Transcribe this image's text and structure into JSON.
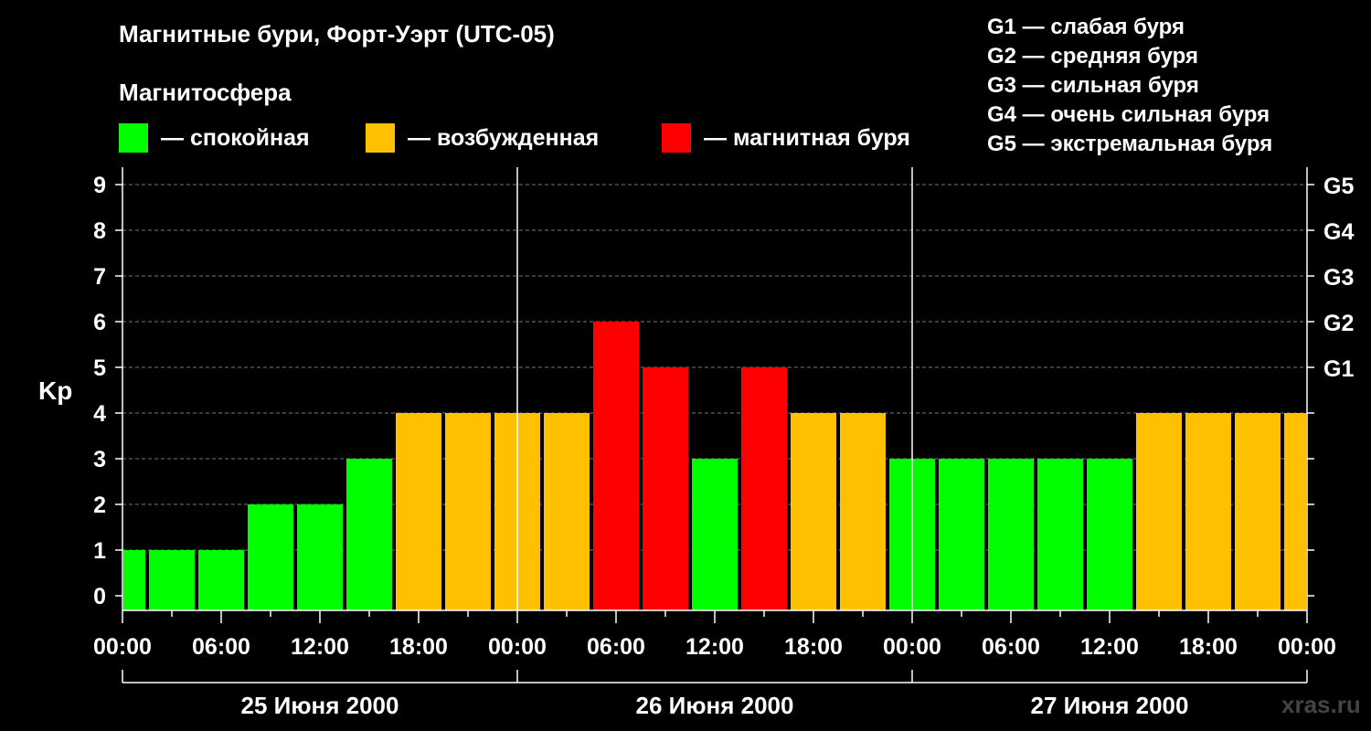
{
  "title": "Магнитные бури, Форт-Уэрт (UTC-05)",
  "subtitle": "Магнитосфера",
  "legend": [
    {
      "label": "— спокойная",
      "color": "#00ff00"
    },
    {
      "label": "— возбужденная",
      "color": "#ffc000"
    },
    {
      "label": "— магнитная буря",
      "color": "#ff0000"
    }
  ],
  "g_legend": [
    "G1 — слабая буря",
    "G2 — средняя буря",
    "G3 — сильная буря",
    "G4 — очень сильная буря",
    "G5 — экстремальная буря"
  ],
  "watermark": "xras.ru",
  "colors": {
    "quiet": "#00ff00",
    "active": "#ffc000",
    "storm": "#ff0000",
    "grid": "#777777"
  },
  "chart_data": {
    "type": "bar",
    "ylabel": "Kp",
    "ylim": [
      0,
      9
    ],
    "yticks": [
      "0",
      "1",
      "2",
      "3",
      "4",
      "5",
      "6",
      "7",
      "8",
      "9"
    ],
    "right_ticks": [
      {
        "value": 5,
        "label": "G1"
      },
      {
        "value": 6,
        "label": "G2"
      },
      {
        "value": 7,
        "label": "G3"
      },
      {
        "value": 8,
        "label": "G4"
      },
      {
        "value": 9,
        "label": "G5"
      }
    ],
    "xtick_labels": [
      "00:00",
      "06:00",
      "12:00",
      "18:00",
      "00:00",
      "06:00",
      "12:00",
      "18:00",
      "00:00",
      "06:00",
      "12:00",
      "18:00",
      "00:00"
    ],
    "days": [
      "25 Июня 2000",
      "26 Июня 2000",
      "27 Июня 2000"
    ],
    "bar_interval_hours": 3,
    "values": [
      1,
      1,
      1,
      2,
      2,
      3,
      4,
      4,
      4,
      4,
      6,
      5,
      3,
      5,
      4,
      4,
      3,
      3,
      3,
      3,
      3,
      4,
      4,
      4,
      4
    ],
    "grid": "dashed horizontal at each Kp level"
  }
}
